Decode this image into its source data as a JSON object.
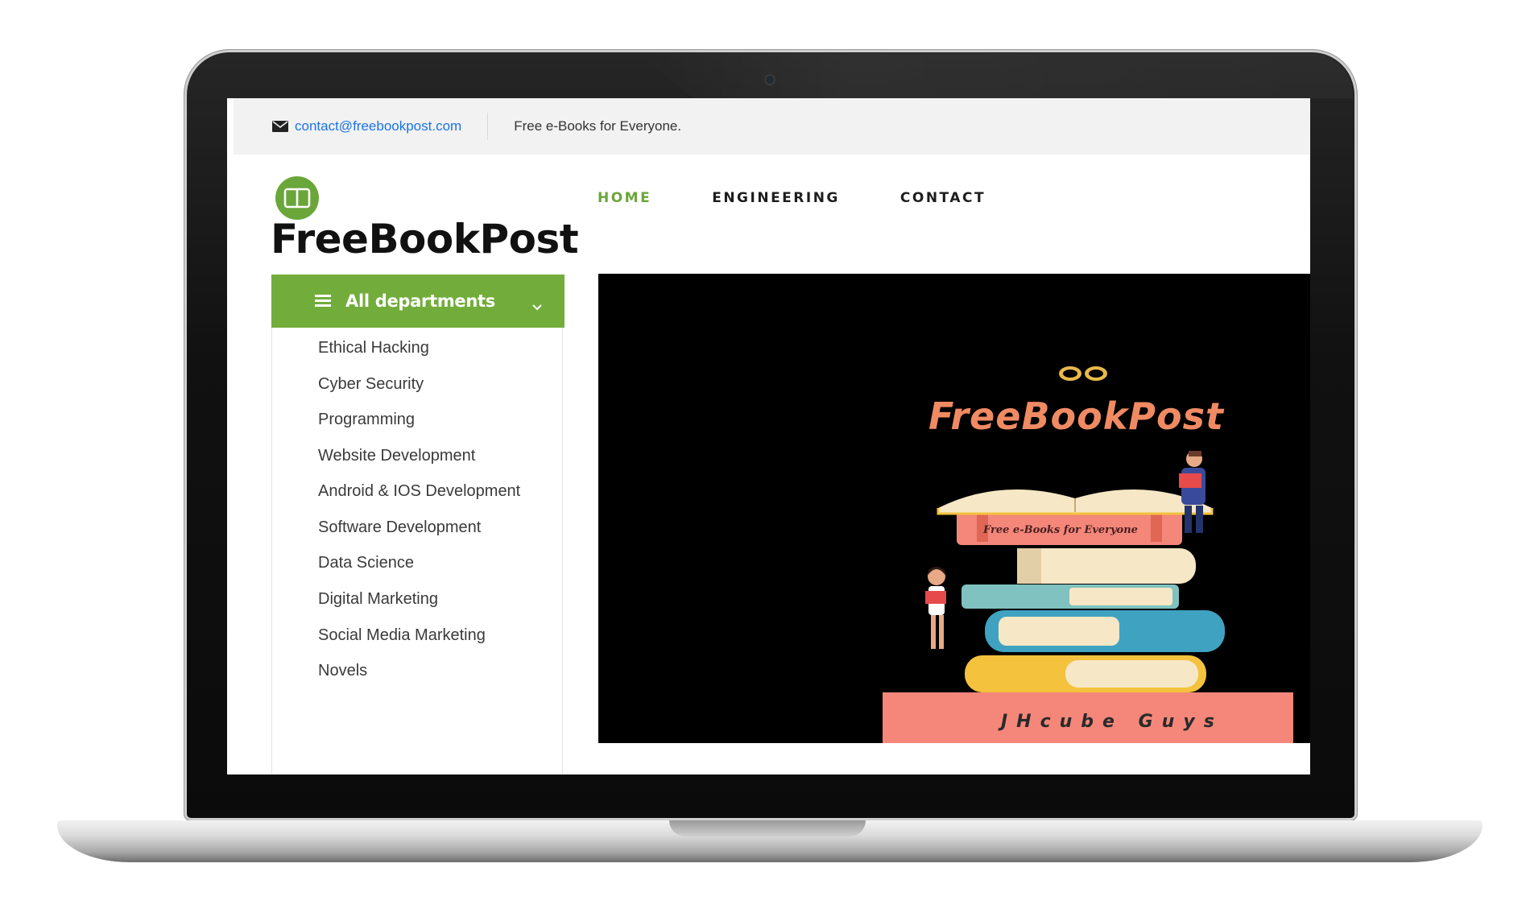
{
  "topbar": {
    "email": "contact@freebookpost.com",
    "tagline": "Free e-Books for Everyone."
  },
  "logo": {
    "text": "FreeBookPost"
  },
  "nav": {
    "items": [
      {
        "label": "HOME",
        "active": true
      },
      {
        "label": "ENGINEERING",
        "active": false
      },
      {
        "label": "CONTACT",
        "active": false
      }
    ]
  },
  "departments": {
    "header": "All departments",
    "items": [
      {
        "label": "Ethical Hacking"
      },
      {
        "label": "Cyber Security"
      },
      {
        "label": "Programming"
      },
      {
        "label": "Website Development"
      },
      {
        "label": "Android & IOS Development"
      },
      {
        "label": "Software Development"
      },
      {
        "label": "Data Science"
      },
      {
        "label": "Digital Marketing"
      },
      {
        "label": "Social Media Marketing"
      },
      {
        "label": "Novels"
      }
    ]
  },
  "banner": {
    "title": "FreeBookPost",
    "book_tag": "Free e-Books for Everyone",
    "footer": "JHcube Guys"
  },
  "colors": {
    "brand_green": "#72ad3b",
    "link_blue": "#1a73e8",
    "banner_salmon": "#f08a63"
  },
  "icons": {
    "mail": "envelope-icon",
    "logo": "open-book-icon",
    "menu": "hamburger-icon",
    "dropdown": "chevron-down-icon"
  }
}
